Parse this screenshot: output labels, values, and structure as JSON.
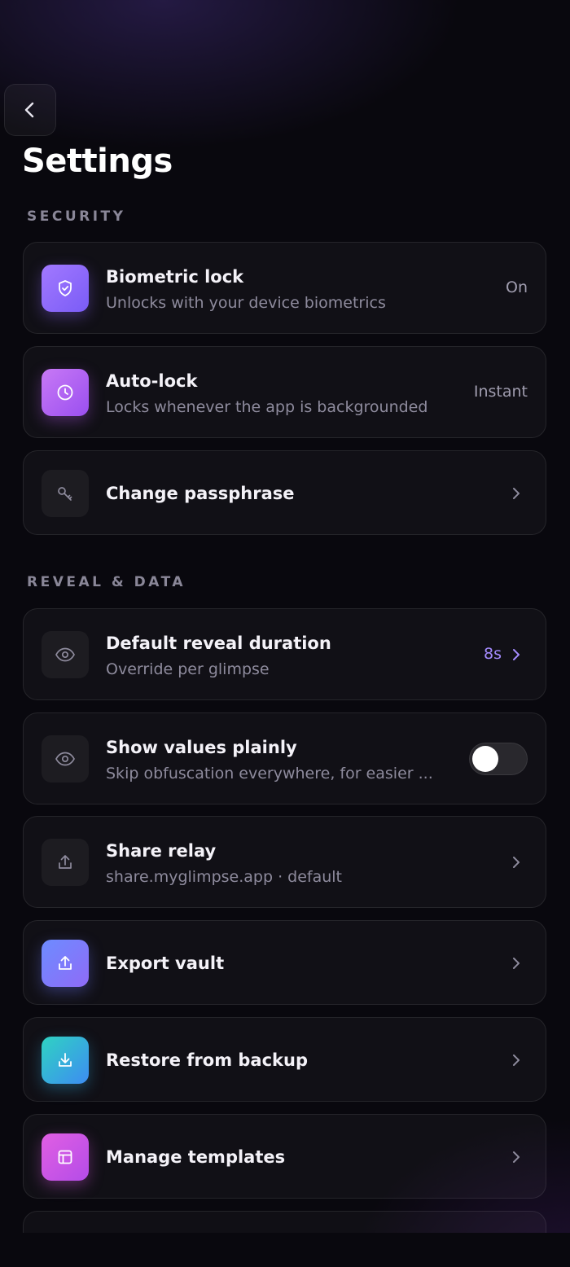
{
  "header": {
    "title": "Settings"
  },
  "sections": {
    "security": "SECURITY",
    "reveal": "REVEAL & DATA"
  },
  "items": {
    "biometric": {
      "title": "Biometric lock",
      "subtitle": "Unlocks with your device biometrics",
      "value": "On",
      "icon": "shield-icon"
    },
    "autolock": {
      "title": "Auto-lock",
      "subtitle": "Locks whenever the app is backgrounded",
      "value": "Instant",
      "icon": "clock-icon"
    },
    "passphrase": {
      "title": "Change passphrase",
      "icon": "key-icon"
    },
    "reveal_duration": {
      "title": "Default reveal duration",
      "subtitle": "Override per glimpse",
      "value": "8s",
      "icon": "eye-icon"
    },
    "show_plain": {
      "title": "Show values plainly",
      "subtitle": "Skip obfuscation everywhere, for easier ...",
      "toggle_on": false,
      "icon": "eye-icon"
    },
    "share_relay": {
      "title": "Share relay",
      "subtitle": "share.myglimpse.app · default",
      "icon": "upload-icon"
    },
    "export": {
      "title": "Export vault",
      "icon": "upload-icon"
    },
    "restore": {
      "title": "Restore from backup",
      "icon": "download-icon"
    },
    "templates": {
      "title": "Manage templates",
      "icon": "template-icon"
    }
  },
  "colors": {
    "background": "#09080e",
    "accent": "#a58bff"
  }
}
